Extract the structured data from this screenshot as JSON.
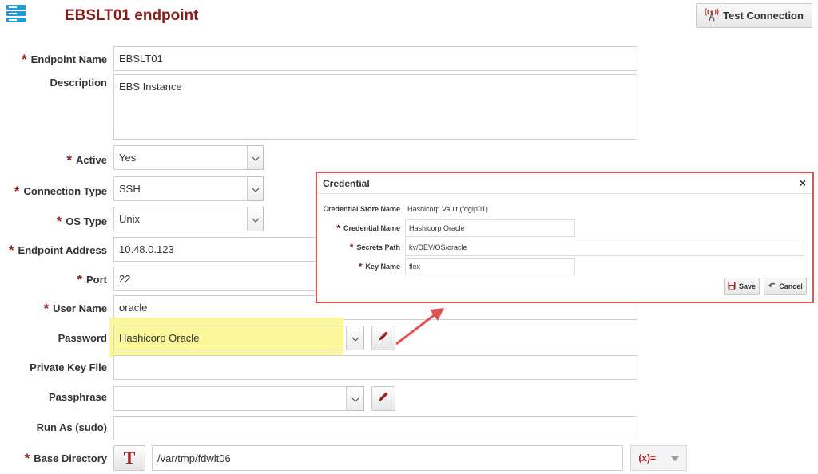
{
  "header": {
    "title": "EBSLT01 endpoint",
    "test_connection_label": "Test Connection"
  },
  "form": {
    "endpoint_name": {
      "label": "Endpoint Name",
      "value": "EBSLT01"
    },
    "description": {
      "label": "Description",
      "value": "EBS Instance"
    },
    "active": {
      "label": "Active",
      "value": "Yes"
    },
    "connection_type": {
      "label": "Connection Type",
      "value": "SSH"
    },
    "os_type": {
      "label": "OS Type",
      "value": "Unix"
    },
    "endpoint_address": {
      "label": "Endpoint Address",
      "value": "10.48.0.123"
    },
    "port": {
      "label": "Port",
      "value": "22"
    },
    "user_name": {
      "label": "User Name",
      "value": "oracle"
    },
    "password": {
      "label": "Password",
      "value": "Hashicorp Oracle"
    },
    "private_key_file": {
      "label": "Private Key File",
      "value": ""
    },
    "passphrase": {
      "label": "Passphrase",
      "value": ""
    },
    "run_as": {
      "label": "Run As (sudo)",
      "value": ""
    },
    "base_directory": {
      "label": "Base Directory",
      "value": "/var/tmp/fdwlt06",
      "text_button": "T",
      "variable_label": "(x)="
    }
  },
  "dialog": {
    "title": "Credential",
    "close": "×",
    "store_name_label": "Credential Store Name",
    "store_name_value": "Hashicorp Vault (fdglp01)",
    "credential_name": {
      "label": "Credential Name",
      "value": "Hashicorp Oracle"
    },
    "secrets_path": {
      "label": "Secrets Path",
      "value": "kv/DEV/OS/oracle"
    },
    "key_name": {
      "label": "Key Name",
      "value": "flex"
    },
    "save_label": "Save",
    "cancel_label": "Cancel"
  },
  "colors": {
    "title": "#8a1c1c",
    "required_star": "#8a1c1c",
    "highlight": "#fbf79a",
    "dialog_border": "#e05353",
    "edit_icon": "#a41f24"
  },
  "icons": [
    "server-stack-icon",
    "antenna-icon",
    "chevron-down-icon",
    "pencil-icon",
    "save-icon",
    "undo-icon",
    "close-icon"
  ]
}
